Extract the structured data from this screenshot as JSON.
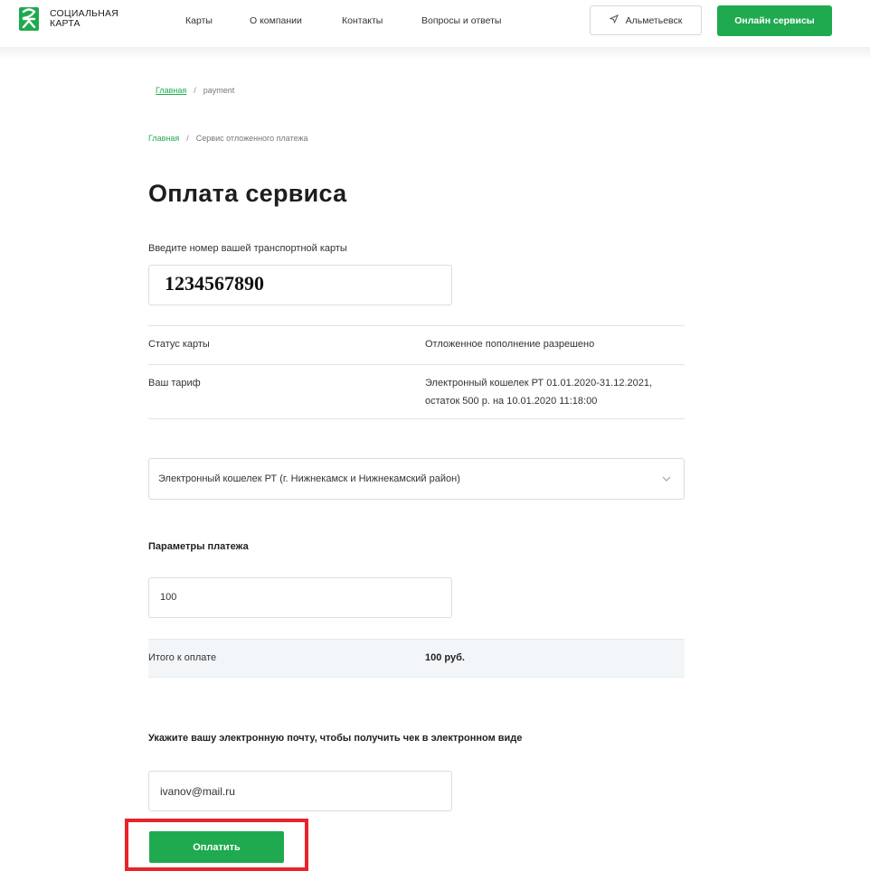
{
  "header": {
    "logo_line1": "СОЦИАЛЬНАЯ",
    "logo_line2": "КАРТА",
    "nav": [
      "Карты",
      "О компании",
      "Контакты",
      "Вопросы и ответы"
    ],
    "city": "Альметьевск",
    "online_button": "Онлайн сервисы"
  },
  "breadcrumb1": {
    "home": "Главная",
    "sep": "/",
    "current": "payment"
  },
  "breadcrumb2": {
    "home": "Главная",
    "sep": "/",
    "current": "Сервис отложенного платежа"
  },
  "title": "Оплата сервиса",
  "card": {
    "label": "Введите номер вашей транспортной карты",
    "value": "1234567890"
  },
  "info": {
    "status_label": "Статус карты",
    "status_value": "Отложенное пополнение разрешено",
    "tariff_label": "Ваш тариф",
    "tariff_value_line1": "Электронный кошелек РТ 01.01.2020-31.12.2021,",
    "tariff_value_line2": "остаток 500 р. на 10.01.2020 11:18:00"
  },
  "select": {
    "value": "Электронный кошелек РТ (г. Нижнекамск и Нижнекамский район)"
  },
  "payment": {
    "heading": "Параметры платежа",
    "amount": "100",
    "total_label": "Итого к оплате",
    "total_value": "100 руб."
  },
  "email": {
    "heading": "Укажите вашу электронную почту, чтобы получить чек в электронном виде",
    "value": "ivanov@mail.ru"
  },
  "pay_button": "Оплатить",
  "colors": {
    "brand": "#1faa4f",
    "highlight": "#e8242b"
  },
  "icons": {
    "logo": "social-card-logo",
    "city": "location-arrow-icon",
    "select": "chevron-down-icon"
  }
}
